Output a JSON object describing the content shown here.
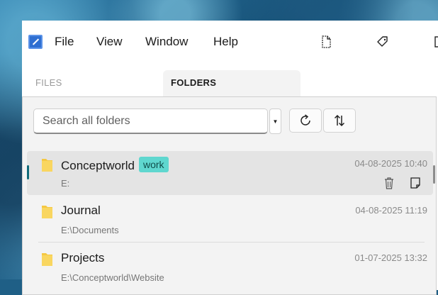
{
  "menu": {
    "file": "File",
    "view": "View",
    "window": "Window",
    "help": "Help"
  },
  "tabs": {
    "files": "FILES",
    "folders": "FOLDERS"
  },
  "search": {
    "placeholder": "Search all folders",
    "value": ""
  },
  "icons": {
    "app": "app-logo-icon",
    "new_document": "new-document-icon",
    "tag": "tag-icon",
    "refresh": "refresh-icon",
    "sort": "sort-icon",
    "folder": "folder-icon",
    "delete": "trash-icon",
    "note": "note-icon"
  },
  "colors": {
    "accent": "#0f6b7a",
    "tag_bg": "#5fd7cf",
    "folder": "#f5c842"
  },
  "folders": [
    {
      "name": "Conceptworld",
      "tag": "work",
      "path": "E:",
      "date": "04-08-2025 10:40"
    },
    {
      "name": "Journal",
      "path": "E:\\Documents",
      "date": "04-08-2025 11:19"
    },
    {
      "name": "Projects",
      "path": "E:\\Conceptworld\\Website",
      "date": "01-07-2025 13:32"
    }
  ]
}
